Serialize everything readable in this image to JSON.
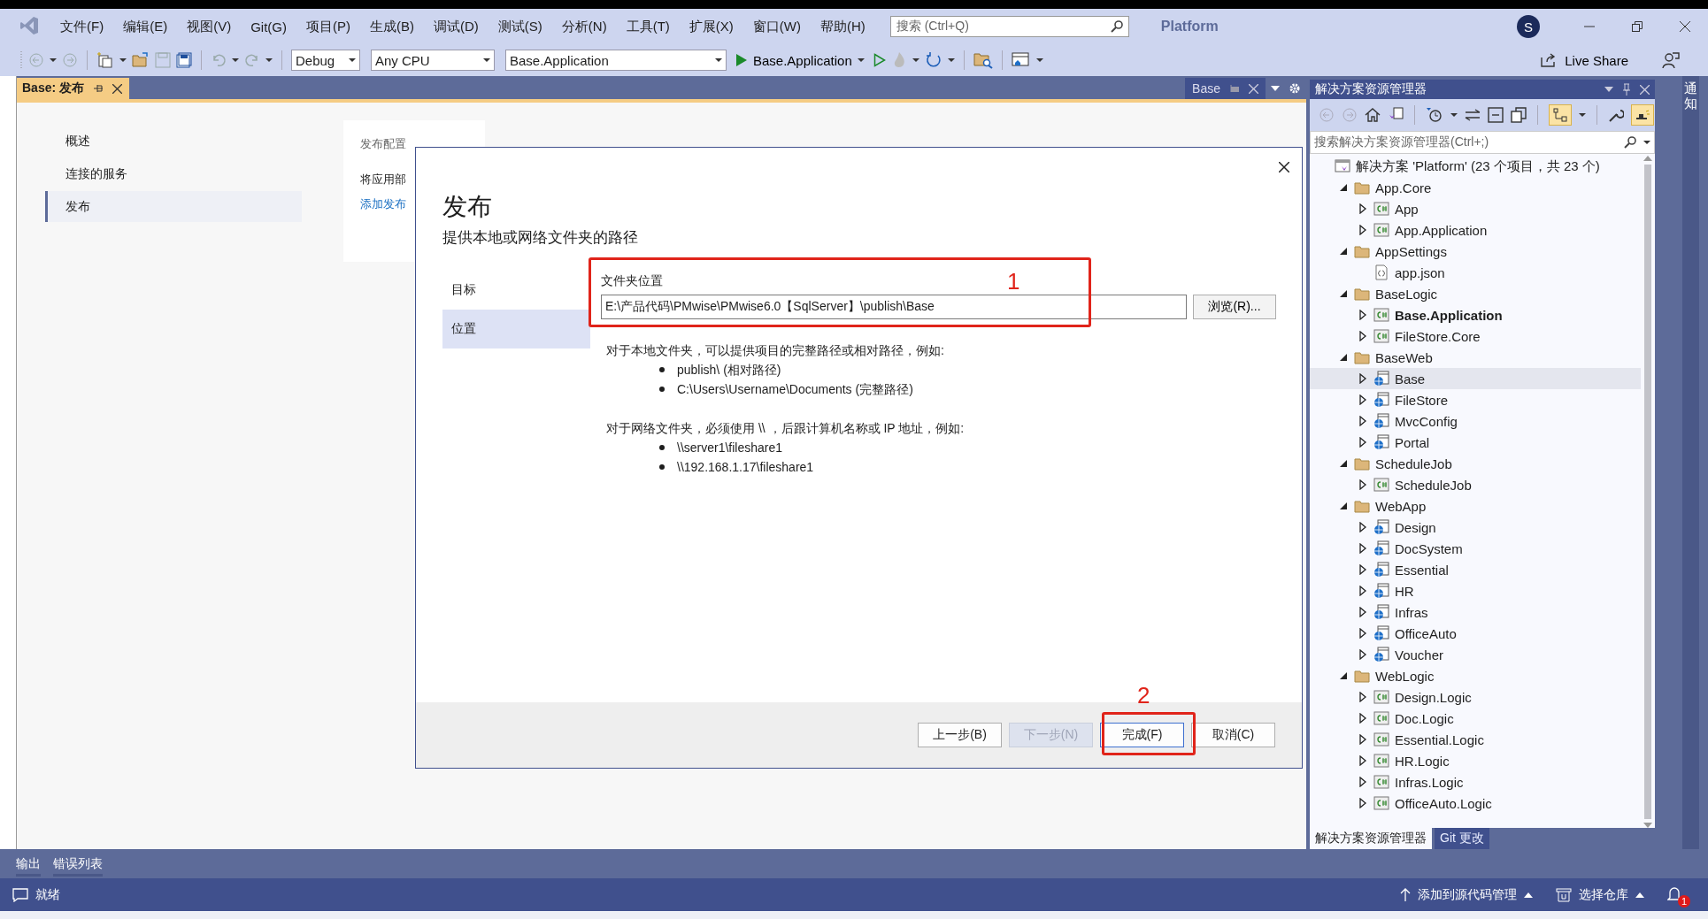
{
  "menu_bar": {
    "items": [
      "文件(F)",
      "编辑(E)",
      "视图(V)",
      "Git(G)",
      "项目(P)",
      "生成(B)",
      "调试(D)",
      "测试(S)",
      "分析(N)",
      "工具(T)",
      "扩展(X)",
      "窗口(W)",
      "帮助(H)"
    ],
    "search": {
      "placeholder": "搜索 (Ctrl+Q)"
    },
    "title": "Platform",
    "avatar": "S"
  },
  "toolbar": {
    "configuration": "Debug",
    "platform": "Any CPU",
    "startup_project": "Base.Application",
    "run_target": "Base.Application",
    "live_share": "Live Share"
  },
  "document_tab": {
    "label": "Base: 发布"
  },
  "preview_tab": {
    "label": "Base"
  },
  "publish_page": {
    "nav": [
      {
        "label": "概述",
        "selected": false
      },
      {
        "label": "连接的服务",
        "selected": false
      },
      {
        "label": "发布",
        "selected": true
      }
    ],
    "card": {
      "heading": "发布配置",
      "text": "将应用部",
      "link": "添加发布"
    }
  },
  "dialog": {
    "title": "发布",
    "subtitle": "提供本地或网络文件夹的路径",
    "steps": [
      {
        "label": "目标",
        "selected": false
      },
      {
        "label": "位置",
        "selected": true
      }
    ],
    "field": {
      "label": "文件夹位置",
      "value": "E:\\产品代码\\PMwise\\PMwise6.0【SqlServer】\\publish\\Base"
    },
    "browse_button": "浏览(R)...",
    "help": [
      {
        "text": "对于本地文件夹，可以提供项目的完整路径或相对路径，例如:",
        "bullets": [
          "publish\\ (相对路径)",
          "C:\\Users\\Username\\Documents (完整路径)"
        ]
      },
      {
        "text": "对于网络文件夹，必须使用 \\\\ ，后跟计算机名称或 IP 地址，例如:",
        "bullets": [
          "\\\\server1\\fileshare1",
          "\\\\192.168.1.17\\fileshare1"
        ]
      }
    ],
    "buttons": [
      {
        "label": "上一步(B)",
        "disabled": false
      },
      {
        "label": "下一步(N)",
        "disabled": true
      },
      {
        "label": "完成(F)",
        "disabled": false
      },
      {
        "label": "取消(C)",
        "disabled": false
      }
    ],
    "annotations": [
      "1",
      "2"
    ]
  },
  "solution_explorer": {
    "title": "解决方案资源管理器",
    "search": {
      "placeholder": "搜索解决方案资源管理器(Ctrl+;)"
    },
    "tree": [
      {
        "label": "解决方案 'Platform' (23 个项目，共 23 个)",
        "kind": "solution",
        "selected": false,
        "startup": false,
        "children": [
          {
            "label": "App.Core",
            "kind": "folder",
            "expanded": true,
            "selected": false,
            "startup": false,
            "children": [
              {
                "label": "App",
                "kind": "csharp",
                "expanded": false,
                "selected": false,
                "startup": false
              },
              {
                "label": "App.Application",
                "kind": "csharp",
                "expanded": false,
                "selected": false,
                "startup": false
              }
            ]
          },
          {
            "label": "AppSettings",
            "kind": "folder",
            "expanded": true,
            "selected": false,
            "startup": false,
            "children": [
              {
                "label": "app.json",
                "kind": "json",
                "selected": false,
                "startup": false
              }
            ]
          },
          {
            "label": "BaseLogic",
            "kind": "folder",
            "expanded": true,
            "selected": false,
            "startup": false,
            "children": [
              {
                "label": "Base.Application",
                "kind": "csharp",
                "expanded": false,
                "selected": false,
                "startup": true
              },
              {
                "label": "FileStore.Core",
                "kind": "csharp",
                "expanded": false,
                "selected": false,
                "startup": false
              }
            ]
          },
          {
            "label": "BaseWeb",
            "kind": "folder",
            "expanded": true,
            "selected": false,
            "startup": false,
            "children": [
              {
                "label": "Base",
                "kind": "web",
                "expanded": false,
                "selected": true,
                "startup": false
              },
              {
                "label": "FileStore",
                "kind": "web",
                "expanded": false,
                "selected": false,
                "startup": false
              },
              {
                "label": "MvcConfig",
                "kind": "web",
                "expanded": false,
                "selected": false,
                "startup": false
              },
              {
                "label": "Portal",
                "kind": "web",
                "expanded": false,
                "selected": false,
                "startup": false
              }
            ]
          },
          {
            "label": "ScheduleJob",
            "kind": "folder",
            "expanded": true,
            "selected": false,
            "startup": false,
            "children": [
              {
                "label": "ScheduleJob",
                "kind": "csharp",
                "expanded": false,
                "selected": false,
                "startup": false
              }
            ]
          },
          {
            "label": "WebApp",
            "kind": "folder",
            "expanded": true,
            "selected": false,
            "startup": false,
            "children": [
              {
                "label": "Design",
                "kind": "web",
                "expanded": false,
                "selected": false,
                "startup": false
              },
              {
                "label": "DocSystem",
                "kind": "web",
                "expanded": false,
                "selected": false,
                "startup": false
              },
              {
                "label": "Essential",
                "kind": "web",
                "expanded": false,
                "selected": false,
                "startup": false
              },
              {
                "label": "HR",
                "kind": "web",
                "expanded": false,
                "selected": false,
                "startup": false
              },
              {
                "label": "Infras",
                "kind": "web",
                "expanded": false,
                "selected": false,
                "startup": false
              },
              {
                "label": "OfficeAuto",
                "kind": "web",
                "expanded": false,
                "selected": false,
                "startup": false
              },
              {
                "label": "Voucher",
                "kind": "web",
                "expanded": false,
                "selected": false,
                "startup": false
              }
            ]
          },
          {
            "label": "WebLogic",
            "kind": "folder",
            "expanded": true,
            "selected": false,
            "startup": false,
            "children": [
              {
                "label": "Design.Logic",
                "kind": "csharp",
                "expanded": false,
                "selected": false,
                "startup": false
              },
              {
                "label": "Doc.Logic",
                "kind": "csharp",
                "expanded": false,
                "selected": false,
                "startup": false
              },
              {
                "label": "Essential.Logic",
                "kind": "csharp",
                "expanded": false,
                "selected": false,
                "startup": false
              },
              {
                "label": "HR.Logic",
                "kind": "csharp",
                "expanded": false,
                "selected": false,
                "startup": false
              },
              {
                "label": "Infras.Logic",
                "kind": "csharp",
                "expanded": false,
                "selected": false,
                "startup": false
              },
              {
                "label": "OfficeAuto.Logic",
                "kind": "csharp",
                "expanded": false,
                "selected": false,
                "startup": false
              }
            ]
          }
        ]
      }
    ],
    "tabs": [
      {
        "label": "解决方案资源管理器",
        "selected": true
      },
      {
        "label": "Git 更改",
        "selected": false
      }
    ]
  },
  "notification_strip": {
    "label": "通知"
  },
  "bottom_tabs": [
    "输出",
    "错误列表"
  ],
  "status_bar": {
    "status": "就绪",
    "source_control": "添加到源代码管理",
    "repository": "选择仓库",
    "notifications": "1"
  }
}
